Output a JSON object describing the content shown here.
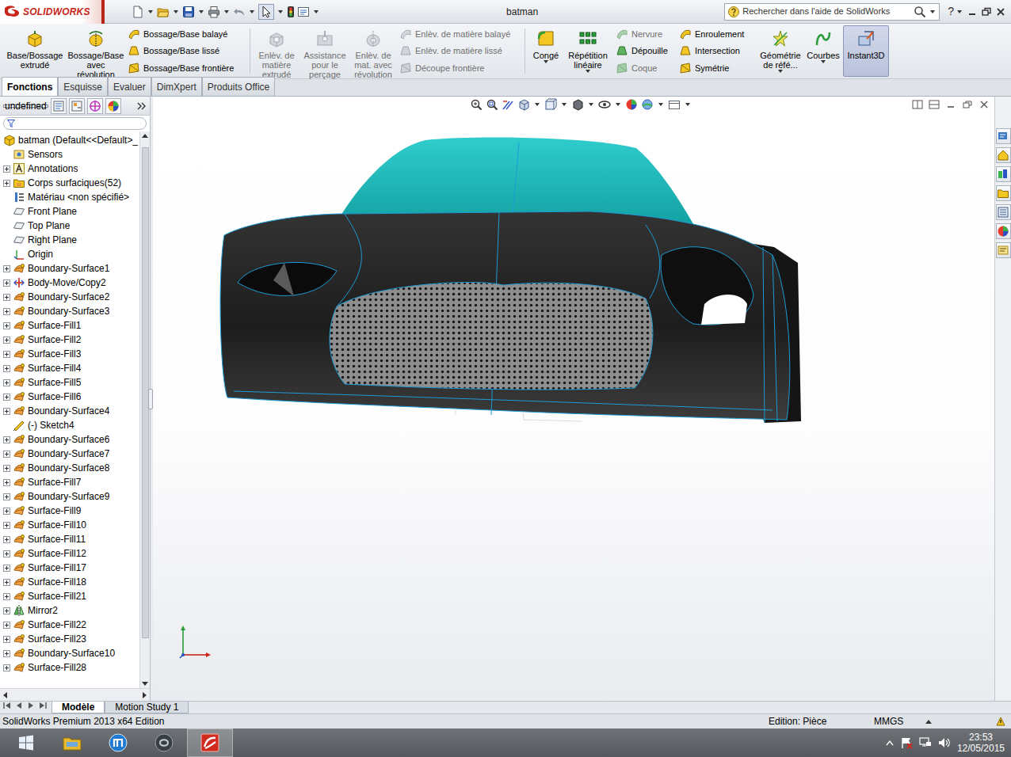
{
  "app": {
    "logo": "SOLIDWORKS"
  },
  "window": {
    "title": "batman"
  },
  "search": {
    "placeholder": "Rechercher dans l'aide de SolidWorks"
  },
  "help": {
    "label": "?"
  },
  "ribbon": {
    "items": [
      {
        "kind": "large",
        "label": "Base/Bossage extrudé",
        "disabled": false,
        "selected": false,
        "dropdown": false
      },
      {
        "kind": "large",
        "label": "Bossage/Base avec révolution",
        "disabled": false,
        "selected": false,
        "dropdown": false
      },
      {
        "kind": "stack",
        "entries": [
          {
            "label": "Bossage/Base balayé",
            "disabled": false
          },
          {
            "label": "Bossage/Base lissé",
            "disabled": false
          },
          {
            "label": "Bossage/Base frontière",
            "disabled": false
          }
        ]
      },
      {
        "kind": "large",
        "label": "Enlèv. de matière extrudé",
        "disabled": true,
        "selected": false,
        "dropdown": false
      },
      {
        "kind": "large",
        "label": "Assistance pour le perçage",
        "disabled": true,
        "selected": false,
        "dropdown": false
      },
      {
        "kind": "large",
        "label": "Enlèv. de mat. avec révolution",
        "disabled": true,
        "selected": false,
        "dropdown": false
      },
      {
        "kind": "stack",
        "entries": [
          {
            "label": "Enlèv. de matière balayé",
            "disabled": true
          },
          {
            "label": "Enlèv. de matière lissé",
            "disabled": true
          },
          {
            "label": "Découpe frontière",
            "disabled": true
          }
        ]
      },
      {
        "kind": "large",
        "label": "Congé",
        "disabled": false,
        "selected": false,
        "dropdown": true
      },
      {
        "kind": "large",
        "label": "Répétition linéaire",
        "disabled": false,
        "selected": false,
        "dropdown": true
      },
      {
        "kind": "stack",
        "entries": [
          {
            "label": "Nervure",
            "disabled": true
          },
          {
            "label": "Dépouille",
            "disabled": false
          },
          {
            "label": "Coque",
            "disabled": true
          }
        ]
      },
      {
        "kind": "stack",
        "entries": [
          {
            "label": "Enroulement",
            "disabled": false
          },
          {
            "label": "Intersection",
            "disabled": false
          },
          {
            "label": "Symétrie",
            "disabled": false
          }
        ]
      },
      {
        "kind": "large",
        "label": "Géométrie de réfé...",
        "disabled": false,
        "selected": false,
        "dropdown": true
      },
      {
        "kind": "large",
        "label": "Courbes",
        "disabled": false,
        "selected": false,
        "dropdown": true
      },
      {
        "kind": "large",
        "label": "Instant3D",
        "disabled": false,
        "selected": true,
        "dropdown": false
      }
    ]
  },
  "tabs": [
    {
      "label": "Fonctions",
      "selected": true
    },
    {
      "label": "Esquisse",
      "selected": false
    },
    {
      "label": "Evaluer",
      "selected": false
    },
    {
      "label": "DimXpert",
      "selected": false
    },
    {
      "label": "Produits Office",
      "selected": false
    }
  ],
  "tree": {
    "root": {
      "label": "batman (Default<<Default>_"
    },
    "items": [
      {
        "label": "Sensors",
        "kind": "sensors",
        "expandable": false
      },
      {
        "label": "Annotations",
        "kind": "annotations",
        "expandable": true
      },
      {
        "label": "Corps surfaciques(52)",
        "kind": "bodies",
        "expandable": true
      },
      {
        "label": "Matériau <non spécifié>",
        "kind": "material",
        "expandable": false
      },
      {
        "label": "Front Plane",
        "kind": "plane",
        "expandable": false
      },
      {
        "label": "Top Plane",
        "kind": "plane",
        "expandable": false
      },
      {
        "label": "Right Plane",
        "kind": "plane",
        "expandable": false
      },
      {
        "label": "Origin",
        "kind": "origin",
        "expandable": false
      },
      {
        "label": "Boundary-Surface1",
        "kind": "surface",
        "expandable": true
      },
      {
        "label": "Body-Move/Copy2",
        "kind": "move",
        "expandable": true
      },
      {
        "label": "Boundary-Surface2",
        "kind": "surface",
        "expandable": true
      },
      {
        "label": "Boundary-Surface3",
        "kind": "surface",
        "expandable": true
      },
      {
        "label": "Surface-Fill1",
        "kind": "surface",
        "expandable": true
      },
      {
        "label": "Surface-Fill2",
        "kind": "surface",
        "expandable": true
      },
      {
        "label": "Surface-Fill3",
        "kind": "surface",
        "expandable": true
      },
      {
        "label": "Surface-Fill4",
        "kind": "surface",
        "expandable": true
      },
      {
        "label": "Surface-Fill5",
        "kind": "surface",
        "expandable": true
      },
      {
        "label": "Surface-Fill6",
        "kind": "surface",
        "expandable": true
      },
      {
        "label": "Boundary-Surface4",
        "kind": "surface",
        "expandable": true
      },
      {
        "label": "(-) Sketch4",
        "kind": "sketch",
        "expandable": false
      },
      {
        "label": "Boundary-Surface6",
        "kind": "surface",
        "expandable": true
      },
      {
        "label": "Boundary-Surface7",
        "kind": "surface",
        "expandable": true
      },
      {
        "label": "Boundary-Surface8",
        "kind": "surface",
        "expandable": true
      },
      {
        "label": "Surface-Fill7",
        "kind": "surface",
        "expandable": true
      },
      {
        "label": "Boundary-Surface9",
        "kind": "surface",
        "expandable": true
      },
      {
        "label": "Surface-Fill9",
        "kind": "surface",
        "expandable": true
      },
      {
        "label": "Surface-Fill10",
        "kind": "surface",
        "expandable": true
      },
      {
        "label": "Surface-Fill11",
        "kind": "surface",
        "expandable": true
      },
      {
        "label": "Surface-Fill12",
        "kind": "surface",
        "expandable": true
      },
      {
        "label": "Surface-Fill17",
        "kind": "surface",
        "expandable": true
      },
      {
        "label": "Surface-Fill18",
        "kind": "surface",
        "expandable": true
      },
      {
        "label": "Surface-Fill21",
        "kind": "surface",
        "expandable": true
      },
      {
        "label": "Mirror2",
        "kind": "mirror",
        "expandable": true
      },
      {
        "label": "Surface-Fill22",
        "kind": "surface",
        "expandable": true
      },
      {
        "label": "Surface-Fill23",
        "kind": "surface",
        "expandable": true
      },
      {
        "label": "Boundary-Surface10",
        "kind": "surface",
        "expandable": true
      },
      {
        "label": "Surface-Fill28",
        "kind": "surface",
        "expandable": true
      }
    ]
  },
  "model_tabs": [
    {
      "label": "Modèle",
      "selected": true
    },
    {
      "label": "Motion Study 1",
      "selected": false
    }
  ],
  "status_bar": {
    "product": "SolidWorks Premium 2013 x64 Edition",
    "mode": "Edition: Pièce",
    "units": "MMGS"
  },
  "taskbar": {
    "apps": [
      {
        "selected": false
      },
      {
        "selected": false
      },
      {
        "selected": false
      },
      {
        "selected": true
      }
    ]
  },
  "clock": {
    "time": "23:53",
    "date": "12/05/2015"
  }
}
